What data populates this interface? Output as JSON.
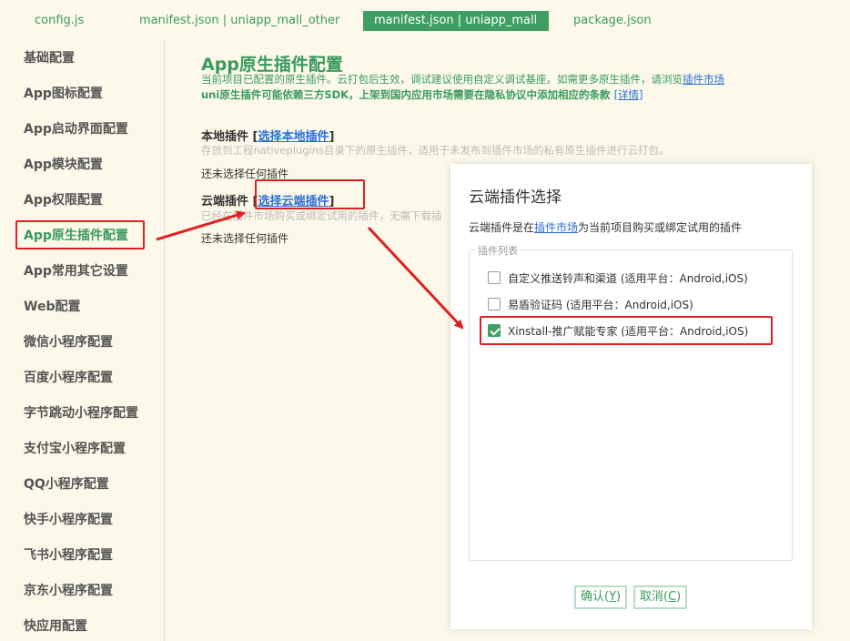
{
  "tabs": [
    {
      "label": "config.js"
    },
    {
      "label": "manifest.json | uniapp_mall_other"
    },
    {
      "label": "manifest.json | uniapp_mall"
    },
    {
      "label": "package.json"
    }
  ],
  "sidebar": {
    "items": [
      {
        "label": "基础配置"
      },
      {
        "label": "App图标配置"
      },
      {
        "label": "App启动界面配置"
      },
      {
        "label": "App模块配置"
      },
      {
        "label": "App权限配置"
      },
      {
        "label": "App原生插件配置"
      },
      {
        "label": "App常用其它设置"
      },
      {
        "label": "Web配置"
      },
      {
        "label": "微信小程序配置"
      },
      {
        "label": "百度小程序配置"
      },
      {
        "label": "字节跳动小程序配置"
      },
      {
        "label": "支付宝小程序配置"
      },
      {
        "label": "QQ小程序配置"
      },
      {
        "label": "快手小程序配置"
      },
      {
        "label": "飞书小程序配置"
      },
      {
        "label": "京东小程序配置"
      },
      {
        "label": "快应用配置"
      }
    ]
  },
  "main": {
    "title": "App原生插件配置",
    "desc1": "当前项目已配置的原生插件。云打包后生效，调试建议使用自定义调试基座。如需更多原生插件，请浏览",
    "desc1_link": "插件市场",
    "desc2": "uni原生插件可能依赖三方SDK，上架到国内应用市场需要在隐私协议中添加相应的条款 ",
    "desc2_link": "[详情]",
    "local": {
      "title": "本地插件 ",
      "link_open": "[",
      "link": "选择本地插件",
      "link_close": "]",
      "note": "存放到工程nativeplugins目录下的原生插件，适用于未发布到插件市场的私有原生插件进行云打包。",
      "empty": "还未选择任何插件"
    },
    "cloud": {
      "title": "云端插件 ",
      "link_open": "[",
      "link": "选择云端插件",
      "link_close": "]",
      "note": "已经在插件市场购买或绑定试用的插件，无需下载插",
      "empty": "还未选择任何插件"
    }
  },
  "dialog": {
    "title": "云端插件选择",
    "desc_before": "云端插件是在",
    "desc_link": "插件市场",
    "desc_after": "为当前项目购买或绑定试用的插件",
    "legend": "插件列表",
    "plugins": [
      {
        "label": "自定义推送铃声和渠道 (适用平台：Android,iOS)",
        "checked": false
      },
      {
        "label": "易盾验证码 (适用平台：Android,iOS)",
        "checked": false
      },
      {
        "label": "Xinstall-推广赋能专家 (适用平台：Android,iOS)",
        "checked": true
      }
    ],
    "confirm": {
      "text": "确认(",
      "key": "Y",
      "end": ")"
    },
    "cancel": {
      "text": "取消(",
      "key": "C",
      "end": ")"
    }
  },
  "colors": {
    "accent": "#3f9e62",
    "highlight": "#e0201f",
    "link": "#2a6fd6",
    "background": "#fcf9ea"
  }
}
